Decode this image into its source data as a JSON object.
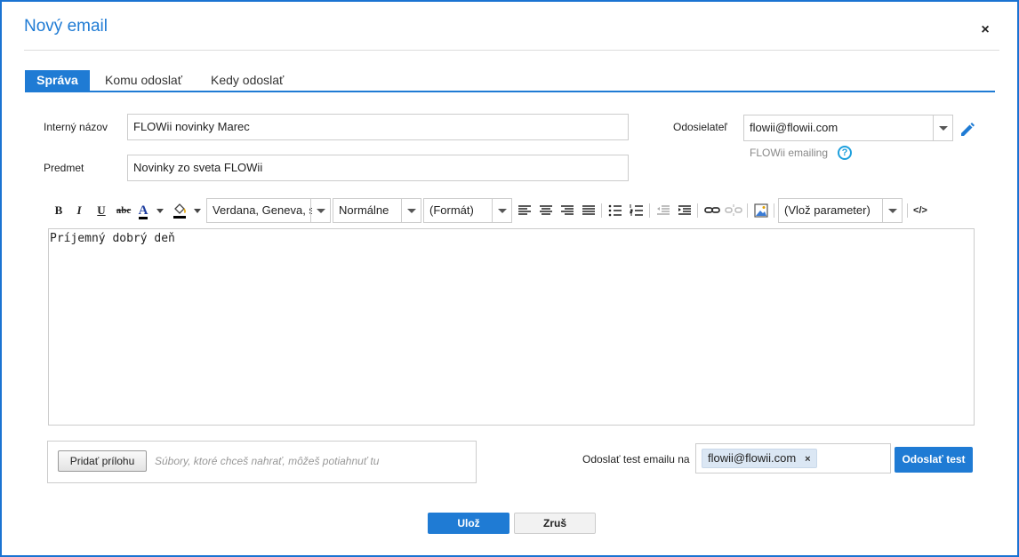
{
  "dialog": {
    "title": "Nový email",
    "close_symbol": "×"
  },
  "tabs": [
    {
      "label": "Správa",
      "active": true
    },
    {
      "label": "Komu odoslať",
      "active": false
    },
    {
      "label": "Kedy odoslať",
      "active": false
    }
  ],
  "form": {
    "internal_name_label": "Interný názov",
    "internal_name_value": "FLOWii novinky Marec",
    "subject_label": "Predmet",
    "subject_value": "Novinky zo sveta FLOWii",
    "sender_label": "Odosielateľ",
    "sender_value": "flowii@flowii.com",
    "sender_helper": "FLOWii emailing",
    "help_symbol": "?"
  },
  "toolbar": {
    "bold": "B",
    "italic": "I",
    "underline": "U",
    "strike": "abc",
    "text_color": "A",
    "font_family": "Verdana, Geneva, s",
    "font_size": "Normálne",
    "format": "(Formát)",
    "insert_parameter": "(Vlož parameter)",
    "source": "</>"
  },
  "editor": {
    "content": "Príjemný dobrý deň"
  },
  "attachments": {
    "button_label": "Pridať prílohu",
    "hint": "Súbory, ktoré chceš nahrať, môžeš potiahnuť tu"
  },
  "test_email": {
    "label": "Odoslať test emailu na",
    "recipient": "flowii@flowii.com",
    "remove_symbol": "×",
    "button_label": "Odoslať test"
  },
  "footer": {
    "save_label": "Ulož",
    "cancel_label": "Zruš"
  },
  "colors": {
    "accent": "#1f7bd4",
    "border": "#1a73d2",
    "chip": "#dbe7f4"
  }
}
